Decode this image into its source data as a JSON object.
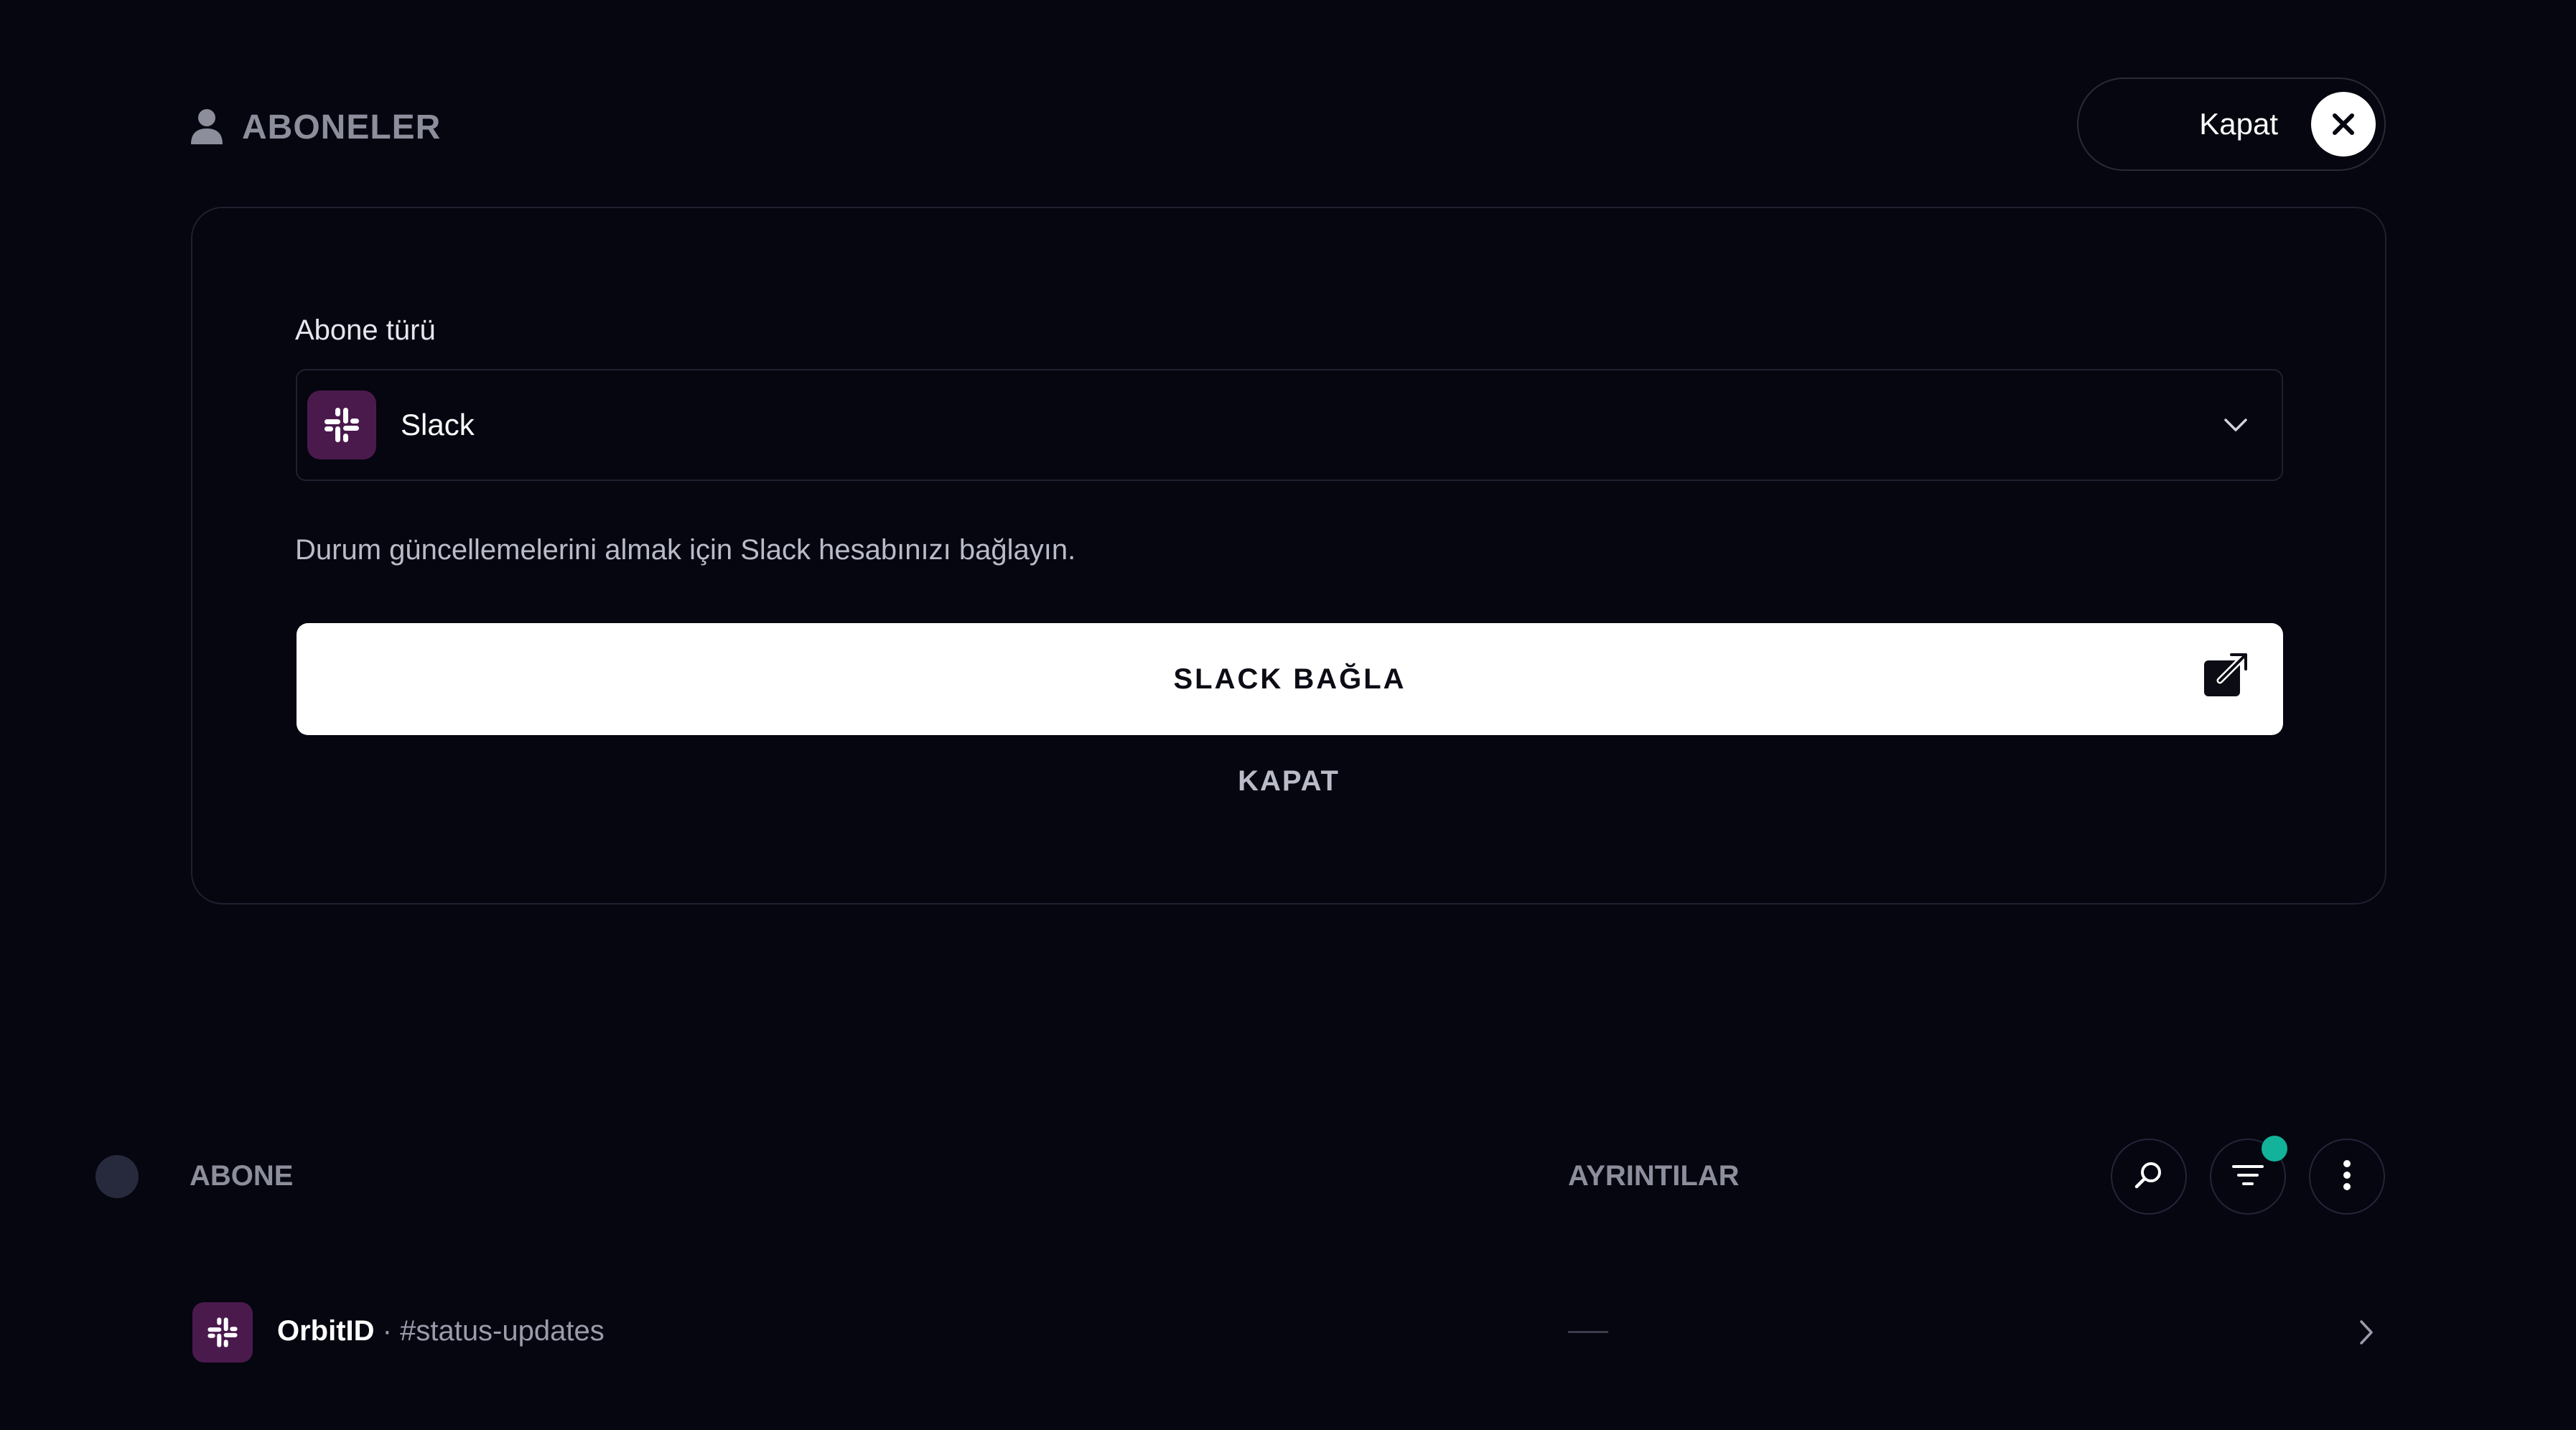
{
  "header": {
    "title": "ABONELER",
    "title_icon": "person-icon",
    "close_label": "Kapat",
    "close_icon": "close-icon"
  },
  "form": {
    "field_label": "Abone türü",
    "selected_type": "Slack",
    "selected_type_icon": "slack-icon",
    "dropdown_icon": "chevron-down-icon",
    "description": "Durum güncellemelerini almak için Slack hesabınızı bağlayın.",
    "connect_label": "SLACK BAĞLA",
    "connect_icon": "external-link-icon",
    "dismiss_label": "KAPAT"
  },
  "table": {
    "columns": [
      "ABONE",
      "AYRINTILAR"
    ],
    "toolbar_icons": [
      "search-icon",
      "filter-icon",
      "more-vertical-icon"
    ],
    "filter_active": true,
    "rows": [
      {
        "name": "OrbitID",
        "separator": " · ",
        "channel": "#status-updates",
        "detail": "—",
        "icon": "slack-icon"
      }
    ]
  },
  "colors": {
    "background": "#05060f",
    "border": "#1f2030",
    "slack_badge": "#4a1a4d",
    "filter_indicator": "#12b39a",
    "muted_text": "#8c8e9c",
    "primary_button": "#ffffff"
  }
}
